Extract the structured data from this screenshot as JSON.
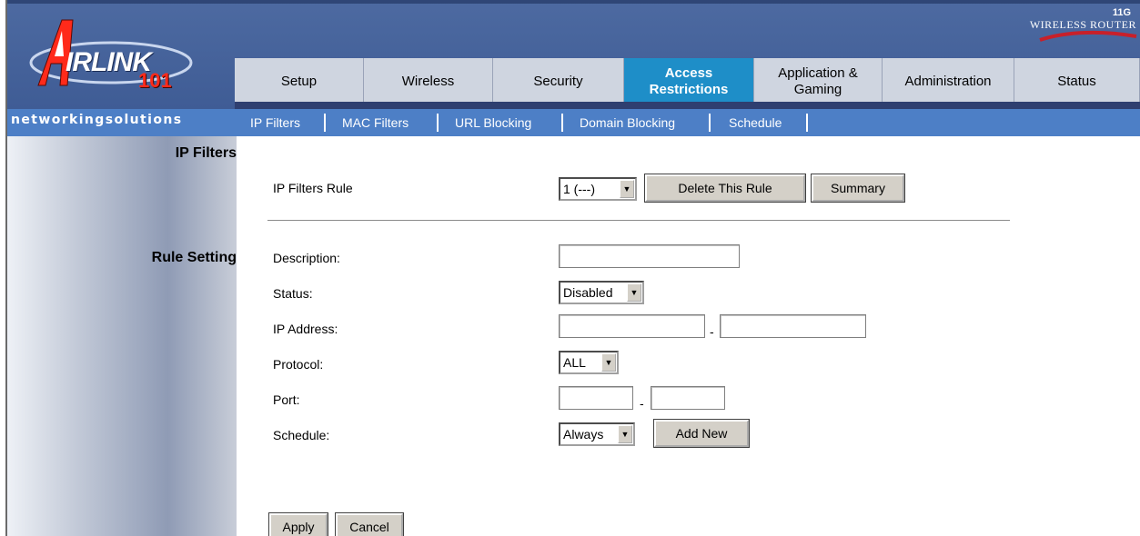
{
  "brand": {
    "logo_word": "IRLINK",
    "logo_number": "101",
    "tagline": "networkingsolutions",
    "badge_top": "11G",
    "badge_word": "WIRELESS ROUTER"
  },
  "tabs": [
    {
      "label": "Setup"
    },
    {
      "label": "Wireless"
    },
    {
      "label": "Security"
    },
    {
      "label": "Access\nRestrictions"
    },
    {
      "label": "Application &\nGaming"
    },
    {
      "label": "Administration"
    },
    {
      "label": "Status"
    }
  ],
  "subnav": [
    {
      "label": "IP Filters"
    },
    {
      "label": "MAC Filters"
    },
    {
      "label": "URL Blocking"
    },
    {
      "label": "Domain Blocking"
    },
    {
      "label": "Schedule"
    }
  ],
  "sections": {
    "ip_filters": "IP Filters",
    "rule_setting": "Rule Setting"
  },
  "rule": {
    "label": "IP Filters Rule",
    "selected": "1 (---)",
    "delete_label": "Delete This Rule",
    "summary_label": "Summary"
  },
  "form": {
    "description_label": "Description:",
    "description_value": "",
    "status_label": "Status:",
    "status_value": "Disabled",
    "ip_label": "IP Address:",
    "ip_start": "",
    "ip_end": "",
    "protocol_label": "Protocol:",
    "protocol_value": "ALL",
    "port_label": "Port:",
    "port_start": "",
    "port_end": "",
    "schedule_label": "Schedule:",
    "schedule_value": "Always",
    "add_new_label": "Add New",
    "range_sep": "-"
  },
  "actions": {
    "apply_label": "Apply",
    "cancel_label": "Cancel"
  }
}
